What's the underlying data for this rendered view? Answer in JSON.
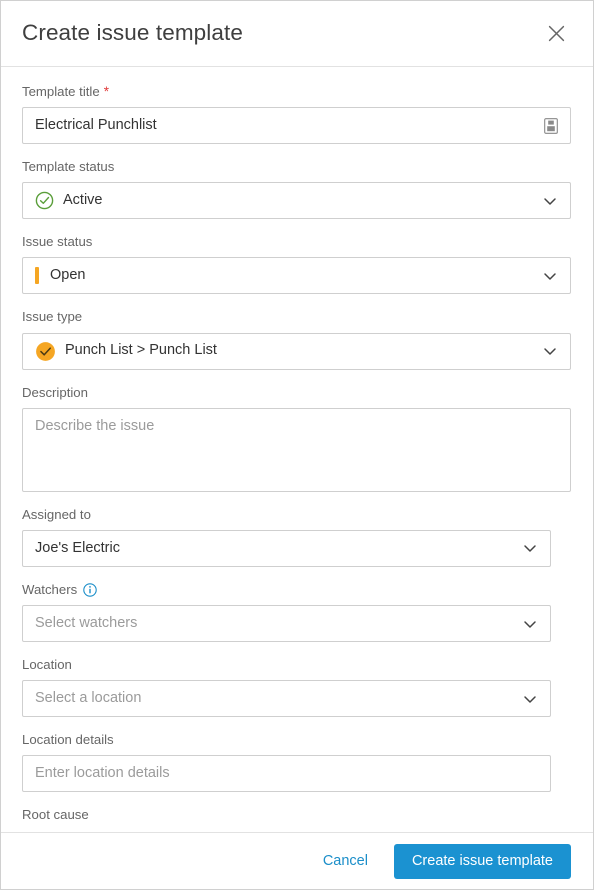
{
  "dialog": {
    "title": "Create issue template",
    "close_icon": "close-icon"
  },
  "form": {
    "template_title": {
      "label": "Template title",
      "required_marker": "*",
      "value": "Electrical Punchlist",
      "trailing_icon": "template-save-icon"
    },
    "template_status": {
      "label": "Template status",
      "value": "Active",
      "icon": "check-circle-outline-icon",
      "icon_color": "#5a9e3a",
      "chevron": "chevron-down-icon"
    },
    "issue_status": {
      "label": "Issue status",
      "value": "Open",
      "status_color": "#f5a623",
      "chevron": "chevron-down-icon"
    },
    "issue_type": {
      "label": "Issue type",
      "value": "Punch List > Punch List",
      "icon": "check-circle-filled-icon",
      "icon_color": "#f5a623",
      "chevron": "chevron-down-icon"
    },
    "description": {
      "label": "Description",
      "value": "",
      "placeholder": "Describe the issue"
    },
    "assigned_to": {
      "label": "Assigned to",
      "value": "Joe's Electric",
      "chevron": "chevron-down-icon"
    },
    "watchers": {
      "label": "Watchers",
      "info_icon": "info-circle-icon",
      "info_icon_color": "#1b8ec9",
      "value": "",
      "placeholder": "Select watchers",
      "chevron": "chevron-down-icon"
    },
    "location": {
      "label": "Location",
      "value": "",
      "placeholder": "Select a location",
      "chevron": "chevron-down-icon"
    },
    "location_details": {
      "label": "Location details",
      "value": "",
      "placeholder": "Enter location details"
    },
    "root_cause": {
      "label": "Root cause"
    }
  },
  "footer": {
    "cancel_label": "Cancel",
    "submit_label": "Create issue template",
    "submit_color": "#1b92d1"
  }
}
